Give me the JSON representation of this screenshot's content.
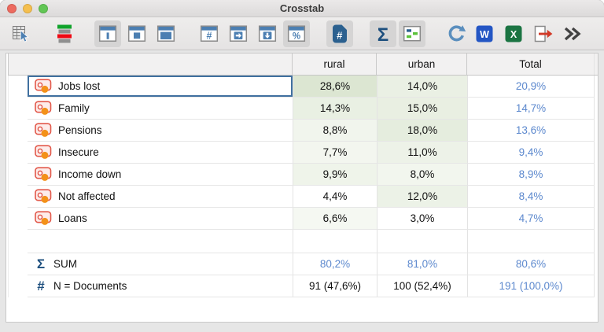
{
  "window": {
    "title": "Crosstab",
    "traffic_lights": [
      {
        "name": "close",
        "color": "#ed6a5f"
      },
      {
        "name": "minimize",
        "color": "#f5bf4f"
      },
      {
        "name": "zoom",
        "color": "#62c655"
      }
    ]
  },
  "glyphs": {
    "sigma": "Σ",
    "hash": "#",
    "percent": "%",
    "word": "W",
    "excel": "X"
  },
  "toolbar": {
    "groups": [
      [
        {
          "icon": "table-select",
          "selected": false
        }
      ],
      [
        {
          "icon": "code-margin",
          "selected": false
        }
      ],
      [
        {
          "icon": "window-thin-bar",
          "selected": true
        },
        {
          "icon": "window-medium-pane",
          "selected": false
        },
        {
          "icon": "window-large-pane",
          "selected": false
        }
      ],
      [
        {
          "icon": "window-hash",
          "selected": false
        },
        {
          "icon": "window-arrow-right",
          "selected": false
        },
        {
          "icon": "window-arrow-down",
          "selected": false
        },
        {
          "icon": "window-percent",
          "selected": true
        }
      ],
      [
        {
          "icon": "badge-hash",
          "selected": true
        }
      ],
      [
        {
          "icon": "sigma",
          "selected": true
        },
        {
          "icon": "highlight-values",
          "selected": true
        }
      ],
      [
        {
          "icon": "refresh",
          "selected": false
        },
        {
          "icon": "word-export",
          "selected": false
        },
        {
          "icon": "excel-export",
          "selected": false
        },
        {
          "icon": "export",
          "selected": false
        },
        {
          "icon": "chevron-double-right",
          "selected": false
        }
      ]
    ]
  },
  "table": {
    "columns": [
      "",
      "rural",
      "urban",
      "Total"
    ],
    "rows": [
      {
        "label": "Jobs lost",
        "rural": "28,6%",
        "urban": "14,0%",
        "total": "20,9%",
        "rural_value": 28.6,
        "urban_value": 14.0,
        "selected": true
      },
      {
        "label": "Family",
        "rural": "14,3%",
        "urban": "15,0%",
        "total": "14,7%",
        "rural_value": 14.3,
        "urban_value": 15.0,
        "selected": false
      },
      {
        "label": "Pensions",
        "rural": "8,8%",
        "urban": "18,0%",
        "total": "13,6%",
        "rural_value": 8.8,
        "urban_value": 18.0,
        "selected": false
      },
      {
        "label": "Insecure",
        "rural": "7,7%",
        "urban": "11,0%",
        "total": "9,4%",
        "rural_value": 7.7,
        "urban_value": 11.0,
        "selected": false
      },
      {
        "label": "Income down",
        "rural": "9,9%",
        "urban": "8,0%",
        "total": "8,9%",
        "rural_value": 9.9,
        "urban_value": 8.0,
        "selected": false
      },
      {
        "label": "Not affected",
        "rural": "4,4%",
        "urban": "12,0%",
        "total": "8,4%",
        "rural_value": 4.4,
        "urban_value": 12.0,
        "selected": false
      },
      {
        "label": "Loans",
        "rural": "6,6%",
        "urban": "3,0%",
        "total": "4,7%",
        "rural_value": 6.6,
        "urban_value": 3.0,
        "selected": false
      }
    ],
    "sum_row": {
      "icon": "sigma",
      "label": "SUM",
      "rural": "80,2%",
      "urban": "81,0%",
      "total": "80,6%"
    },
    "n_row": {
      "icon": "hash",
      "label": "N = Documents",
      "rural": "91 (47,6%)",
      "urban": "100 (52,4%)",
      "total": "191 (100,0%)"
    }
  },
  "colors": {
    "accent_blue": "#5d89ce",
    "selection_border": "#40709f",
    "heat_green_max": "#dce6d2",
    "steel_blue": "#4c7fb2",
    "icon_navy": "#2b608f",
    "sigma_navy": "#1d4f7e",
    "bright_green": "#5cc23c",
    "refresh_blue": "#5b8fbe",
    "word_blue": "#2456c4",
    "excel_green": "#1b7442",
    "export_red": "#d23a28",
    "code_red": "#e2584a",
    "code_pink": "#fdecea",
    "code_orange": "#f39119",
    "traffic_red": "#ed6a5f",
    "traffic_yellow": "#f5bf4f",
    "traffic_green": "#62c655"
  }
}
